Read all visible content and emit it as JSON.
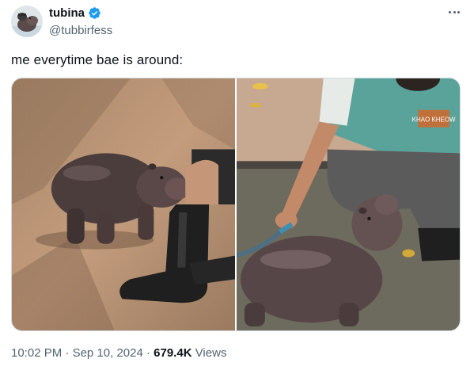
{
  "user": {
    "display_name": "tubina",
    "handle": "@tubbirfess",
    "verified": true,
    "verified_color": "#1d9bf0",
    "avatar_icon": "hippo-avatar-icon"
  },
  "tweet": {
    "text": "me everytime bae is around:",
    "more_icon": "more-options-icon"
  },
  "media": {
    "photos": [
      {
        "label": "baby-hippo-touching-boot-photo"
      },
      {
        "label": "baby-hippo-with-keeper-hose-photo"
      }
    ],
    "shirt_text": "KHAO KHEOW"
  },
  "meta": {
    "time": "10:02 PM",
    "separator": "·",
    "date": "Sep 10, 2024",
    "views_count": "679.4K",
    "views_label": "Views"
  }
}
